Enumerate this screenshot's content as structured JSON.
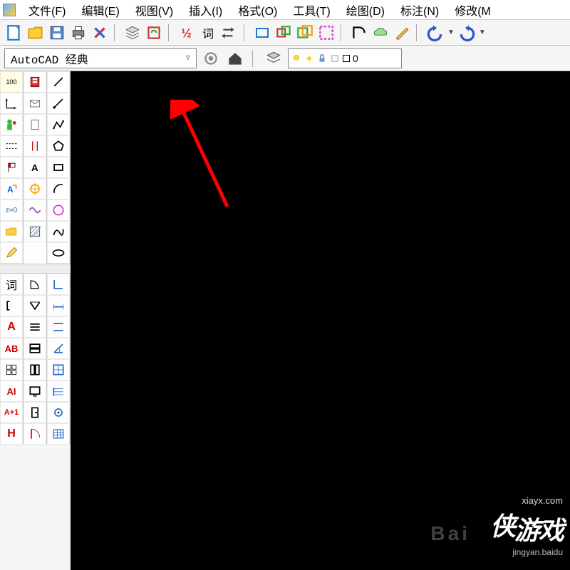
{
  "menus": {
    "file": "文件(F)",
    "edit": "编辑(E)",
    "view": "视图(V)",
    "insert": "插入(I)",
    "format": "格式(O)",
    "tools": "工具(T)",
    "draw": "绘图(D)",
    "dimension": "标注(N)",
    "modify": "修改(M"
  },
  "workspace": {
    "current": "AutoCAD 经典"
  },
  "layer": {
    "current": "0"
  },
  "toolbar_text": {
    "ci": "词"
  },
  "side_text": {
    "ci": "词",
    "aa_red": "A",
    "ab": "AB",
    "ai": "AI",
    "aplus": "A+1",
    "h": "H",
    "z0": "z=0",
    "n100": "100"
  },
  "watermark": {
    "main_a": "侠",
    "main_b": "游戏",
    "url": "xiayx.com",
    "bg": "Bai",
    "sub": "jingyan.baidu"
  }
}
